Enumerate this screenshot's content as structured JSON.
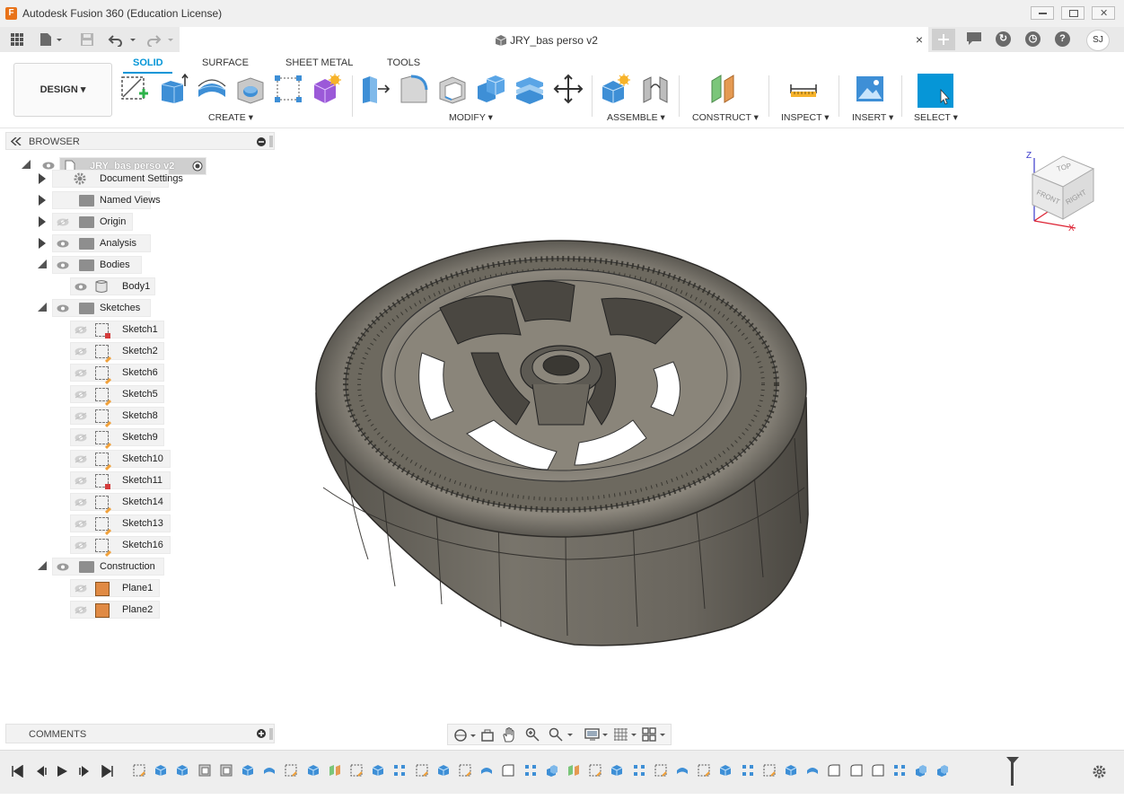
{
  "window": {
    "app_logo": "F",
    "title": "Autodesk Fusion 360 (Education License)"
  },
  "appbar": {
    "doc_title": "JRY_bas perso v2",
    "close": "×",
    "avatar": "SJ"
  },
  "ribbon": {
    "workspace": "DESIGN",
    "tabs": [
      "SOLID",
      "SURFACE",
      "SHEET METAL",
      "TOOLS"
    ],
    "groups": {
      "create": "CREATE",
      "modify": "MODIFY",
      "assemble": "ASSEMBLE",
      "construct": "CONSTRUCT",
      "inspect": "INSPECT",
      "insert": "INSERT",
      "select": "SELECT"
    },
    "dropdown_caret": "▾"
  },
  "browser": {
    "title": "BROWSER",
    "root": "JRY_bas perso v2",
    "items": [
      {
        "label": "Document Settings"
      },
      {
        "label": "Named Views"
      },
      {
        "label": "Origin"
      },
      {
        "label": "Analysis"
      },
      {
        "label": "Bodies"
      },
      {
        "label": "Body1"
      },
      {
        "label": "Sketches"
      },
      {
        "label": "Sketch1"
      },
      {
        "label": "Sketch2"
      },
      {
        "label": "Sketch6"
      },
      {
        "label": "Sketch5"
      },
      {
        "label": "Sketch8"
      },
      {
        "label": "Sketch9"
      },
      {
        "label": "Sketch10"
      },
      {
        "label": "Sketch11"
      },
      {
        "label": "Sketch14"
      },
      {
        "label": "Sketch13"
      },
      {
        "label": "Sketch16"
      },
      {
        "label": "Construction"
      },
      {
        "label": "Plane1"
      },
      {
        "label": "Plane2"
      }
    ]
  },
  "comments": {
    "title": "COMMENTS"
  },
  "viewcube": {
    "top": "TOP",
    "front": "FRONT",
    "right": "RIGHT",
    "axis_z": "Z",
    "axis_x": "X"
  },
  "colors": {
    "accent": "#0696d7",
    "model": "#5e5a52"
  }
}
